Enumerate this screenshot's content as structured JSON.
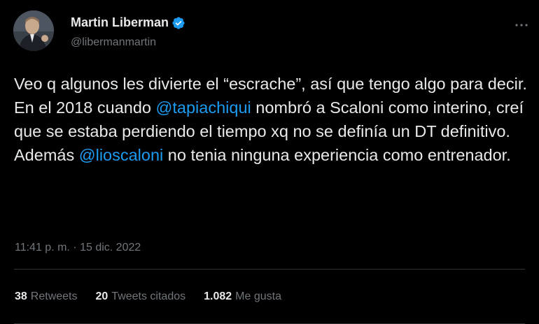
{
  "author": {
    "name": "Martin Liberman",
    "handle": "@libermanmartin",
    "verified_color": "#1d9bf0"
  },
  "tweet": {
    "text_parts": [
      {
        "type": "text",
        "value": "Veo q algunos les divierte el “escrache”, así que tengo algo para decir. En el 2018 cuando "
      },
      {
        "type": "mention",
        "value": "@tapiachiqui"
      },
      {
        "type": "text",
        "value": " nombró a Scaloni como interino, creí que se estaba perdiendo el tiempo xq no se definía un DT definitivo. Además "
      },
      {
        "type": "mention",
        "value": "@lioscaloni"
      },
      {
        "type": "text",
        "value": " no tenia ninguna experiencia como entrenador."
      }
    ],
    "timestamp": "11:41 p. m. · 15 dic. 2022"
  },
  "stats": {
    "retweets": {
      "count": "38",
      "label": "Retweets"
    },
    "quotes": {
      "count": "20",
      "label": "Tweets citados"
    },
    "likes": {
      "count": "1.082",
      "label": "Me gusta"
    }
  },
  "icons": {
    "verified": "verified-badge-icon",
    "more": "more-options-icon"
  },
  "colors": {
    "background": "#000000",
    "text": "#e7e9ea",
    "secondary": "#71767b",
    "accent": "#1d9bf0",
    "divider": "#2f3336"
  }
}
